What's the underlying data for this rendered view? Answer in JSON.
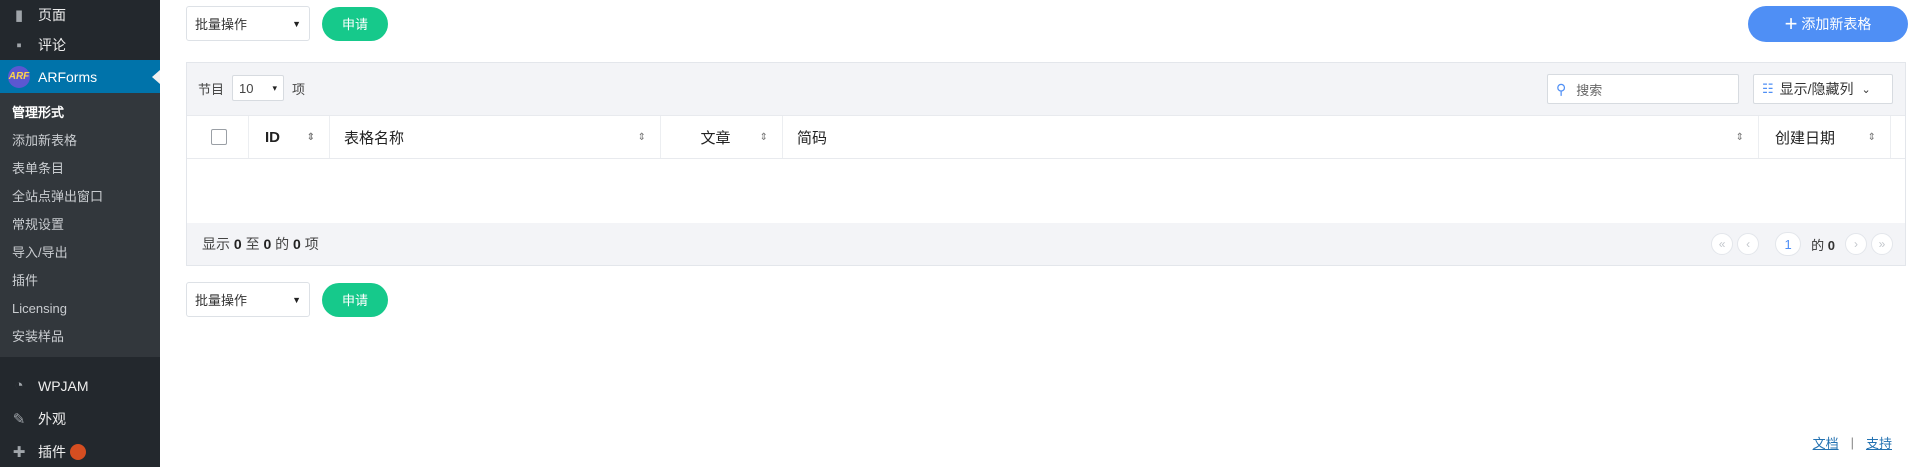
{
  "sidebar": {
    "top_items": [
      {
        "label": "页面",
        "icon": "page-icon"
      },
      {
        "label": "评论",
        "icon": "comment-icon"
      }
    ],
    "active": {
      "label": "ARForms",
      "logo": "ARF"
    },
    "submenu": [
      {
        "label": "管理形式",
        "current": true
      },
      {
        "label": "添加新表格"
      },
      {
        "label": "表单条目"
      },
      {
        "label": "全站点弹出窗口"
      },
      {
        "label": "常规设置"
      },
      {
        "label": "导入/导出"
      },
      {
        "label": "插件"
      },
      {
        "label": "Licensing"
      },
      {
        "label": "安装样品"
      }
    ],
    "bottom_items": [
      {
        "label": "WPJAM",
        "icon": "dashboard-icon"
      },
      {
        "label": "外观",
        "icon": "brush-icon"
      },
      {
        "label": "插件",
        "icon": "plugin-icon"
      }
    ]
  },
  "bulk_top": {
    "select": "批量操作",
    "apply": "申请"
  },
  "bulk_bottom": {
    "select": "批量操作",
    "apply": "申请"
  },
  "add_button": "添加新表格",
  "table": {
    "entries_prefix": "节目",
    "entries_value": "10",
    "entries_suffix": "项",
    "search_placeholder": "搜索",
    "colvis_label": "显示/隐藏列",
    "columns": [
      "ID",
      "表格名称",
      "文章",
      "简码",
      "创建日期"
    ],
    "info": {
      "pre": "显示",
      "from": "0",
      "to_word": "至",
      "to": "0",
      "of_word": "的",
      "total": "0",
      "post": "项"
    },
    "pager": {
      "current": "1",
      "of_label": "的",
      "total_pages": "0"
    }
  },
  "footer": {
    "docs": "文档",
    "sep": "|",
    "support": "支持"
  },
  "colors": {
    "accent": "#4f8ff5",
    "apply": "#16c98b",
    "sidebar": "#23282d",
    "active": "#0073aa"
  }
}
